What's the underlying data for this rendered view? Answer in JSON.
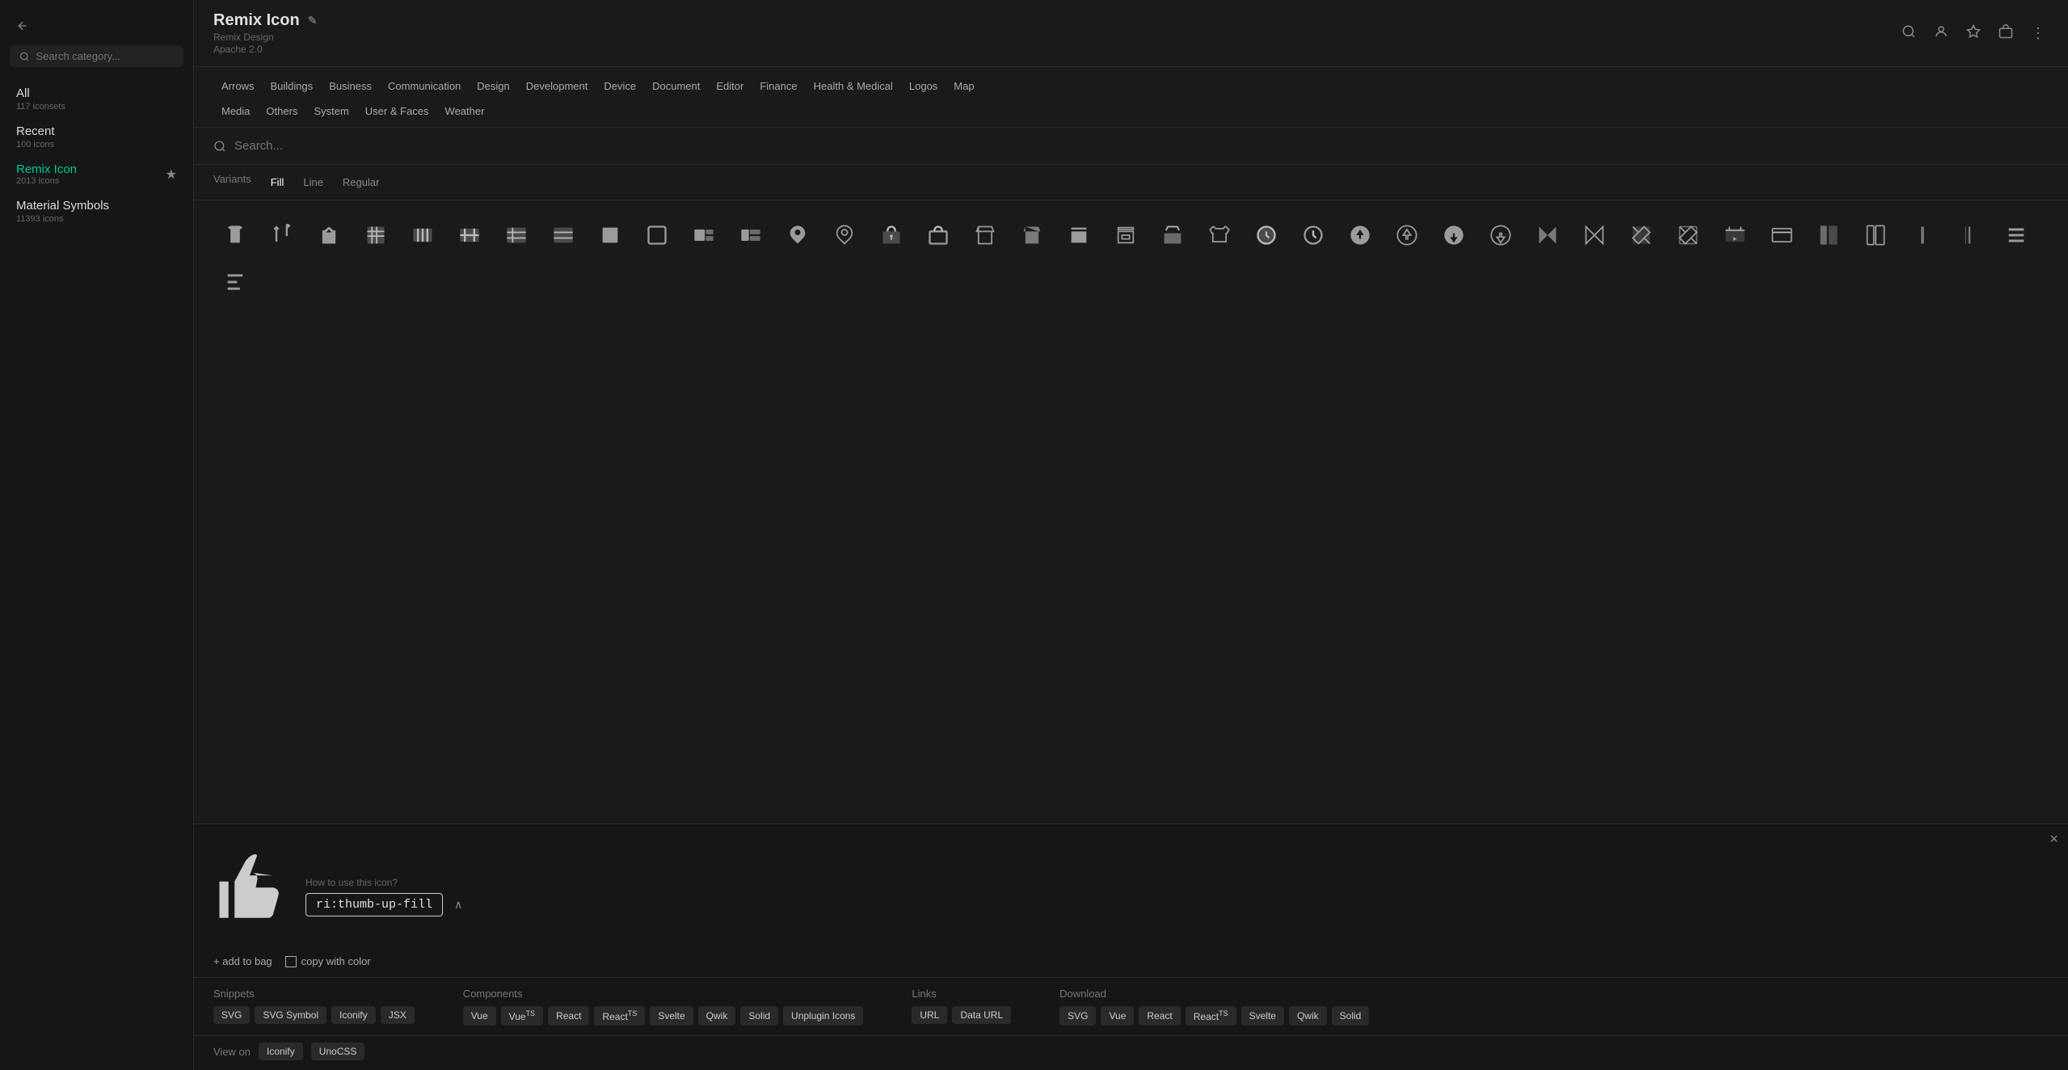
{
  "sidebar": {
    "back_label": "←",
    "search_placeholder": "Search category...",
    "sections": [
      {
        "label": "All",
        "count": "117 iconsets",
        "active": false
      },
      {
        "label": "Recent",
        "count": "100 icons",
        "active": false
      },
      {
        "label": "Remix Icon",
        "count": "2013 icons",
        "active": true,
        "starred": true
      },
      {
        "label": "Material Symbols",
        "count": "11393 icons",
        "active": false
      }
    ]
  },
  "header": {
    "title": "Remix Icon",
    "subtitle": "Remix Design",
    "license": "Apache 2.0",
    "edit_icon": "✎",
    "icons": [
      "🔍",
      "☆",
      "⬛",
      "⋮"
    ]
  },
  "categories": {
    "row1": [
      "Arrows",
      "Buildings",
      "Business",
      "Communication",
      "Design",
      "Development",
      "Device",
      "Document",
      "Editor",
      "Finance",
      "Health & Medical",
      "Logos",
      "Map"
    ],
    "row2": [
      "Media",
      "Others",
      "System",
      "User & Faces",
      "Weather"
    ]
  },
  "search": {
    "placeholder": "Search..."
  },
  "variants": {
    "label": "Variants",
    "options": [
      "Fill",
      "Line",
      "Regular"
    ]
  },
  "icon_grid": {
    "icons": [
      "grid1",
      "grid2",
      "grid3",
      "grid4",
      "grid5",
      "grid6",
      "grid7",
      "grid8",
      "grid9",
      "grid10",
      "grid11",
      "grid12",
      "grid13",
      "grid14",
      "grid15",
      "grid16",
      "grid17",
      "grid18",
      "grid19",
      "grid20",
      "grid21",
      "grid22",
      "grid23",
      "grid24",
      "grid25",
      "grid26",
      "grid27",
      "grid28",
      "grid29",
      "grid30",
      "grid31",
      "grid32",
      "grid33",
      "grid34",
      "grid35",
      "grid36",
      "grid37",
      "grid38",
      "grid39",
      "grid40"
    ]
  },
  "bottom_panel": {
    "close_label": "×",
    "icon_name_hint": "How to use this icon?",
    "icon_code": "ri:thumb-up-fill",
    "collapse_icon": "∧",
    "actions": {
      "add_to_bag": "+ add to bag",
      "copy_with_color": "copy with color"
    }
  },
  "snippets": {
    "title": "Snippets",
    "buttons": [
      "SVG",
      "SVG Symbol",
      "Iconify",
      "JSX"
    ]
  },
  "components": {
    "title": "Components",
    "buttons": [
      "Vue",
      "VueTS",
      "React",
      "ReactTS",
      "Svelte",
      "Qwik",
      "Solid",
      "Unplugin Icons"
    ]
  },
  "links": {
    "title": "Links",
    "buttons": [
      "URL",
      "Data URL"
    ]
  },
  "download": {
    "title": "Download",
    "buttons": [
      "SVG",
      "Vue",
      "React",
      "ReactTS",
      "Svelte",
      "Qwik",
      "Solid"
    ]
  },
  "view_on": {
    "label": "View on",
    "buttons": [
      "Iconify",
      "UnoCSS"
    ]
  }
}
